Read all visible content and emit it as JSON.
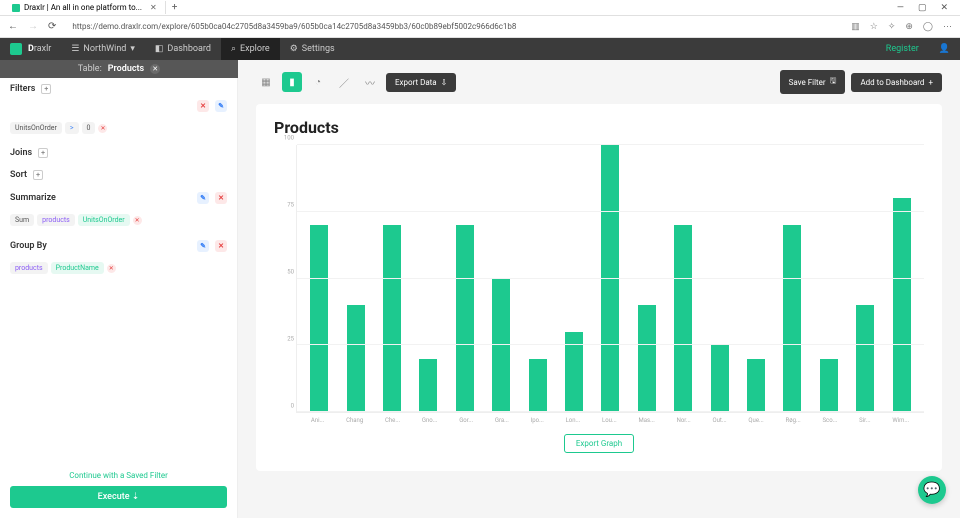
{
  "browser": {
    "tab_title": "Draxlr | An all in one platform to...",
    "url": "https://demo.draxlr.com/explore/605b0ca04c2705d8a3459ba9/605b0ca14c2705d8a3459bb3/60c0b89ebf5002c966d6c1b8"
  },
  "appbar": {
    "brand": "Draxlr",
    "database": "NorthWind",
    "nav": {
      "dashboard": "Dashboard",
      "explore": "Explore",
      "settings": "Settings"
    },
    "register": "Register"
  },
  "table_header": {
    "label": "Table:",
    "name": "Products"
  },
  "sidebar": {
    "filters": {
      "title": "Filters",
      "field": "UnitsOnOrder",
      "op": ">",
      "value": "0"
    },
    "joins": {
      "title": "Joins"
    },
    "sort": {
      "title": "Sort"
    },
    "summarize": {
      "title": "Summarize",
      "agg": "Sum",
      "table": "products",
      "field": "UnitsOnOrder"
    },
    "groupby": {
      "title": "Group By",
      "table": "products",
      "field": "ProductName"
    },
    "saved_filter": "Continue with a Saved Filter",
    "execute": "Execute"
  },
  "toolbar": {
    "export_data": "Export Data",
    "save_filter": "Save Filter",
    "add_dashboard": "Add to Dashboard"
  },
  "chart_data": {
    "type": "bar",
    "title": "Products",
    "categories": [
      "Ani...",
      "Chang",
      "Che...",
      "Gno...",
      "Gor...",
      "Gra...",
      "Ipo...",
      "Lon...",
      "Lou...",
      "Mas...",
      "Nor...",
      "Out...",
      "Que...",
      "Røg...",
      "Sco...",
      "Sir...",
      "Wim..."
    ],
    "values": [
      70,
      40,
      70,
      20,
      70,
      50,
      20,
      30,
      100,
      40,
      70,
      25,
      20,
      70,
      20,
      40,
      80
    ],
    "ylabel": "",
    "xlabel": "",
    "y_ticks": [
      0,
      25,
      50,
      75,
      100
    ],
    "ylim": [
      0,
      100
    ]
  },
  "export_graph": "Export Graph"
}
